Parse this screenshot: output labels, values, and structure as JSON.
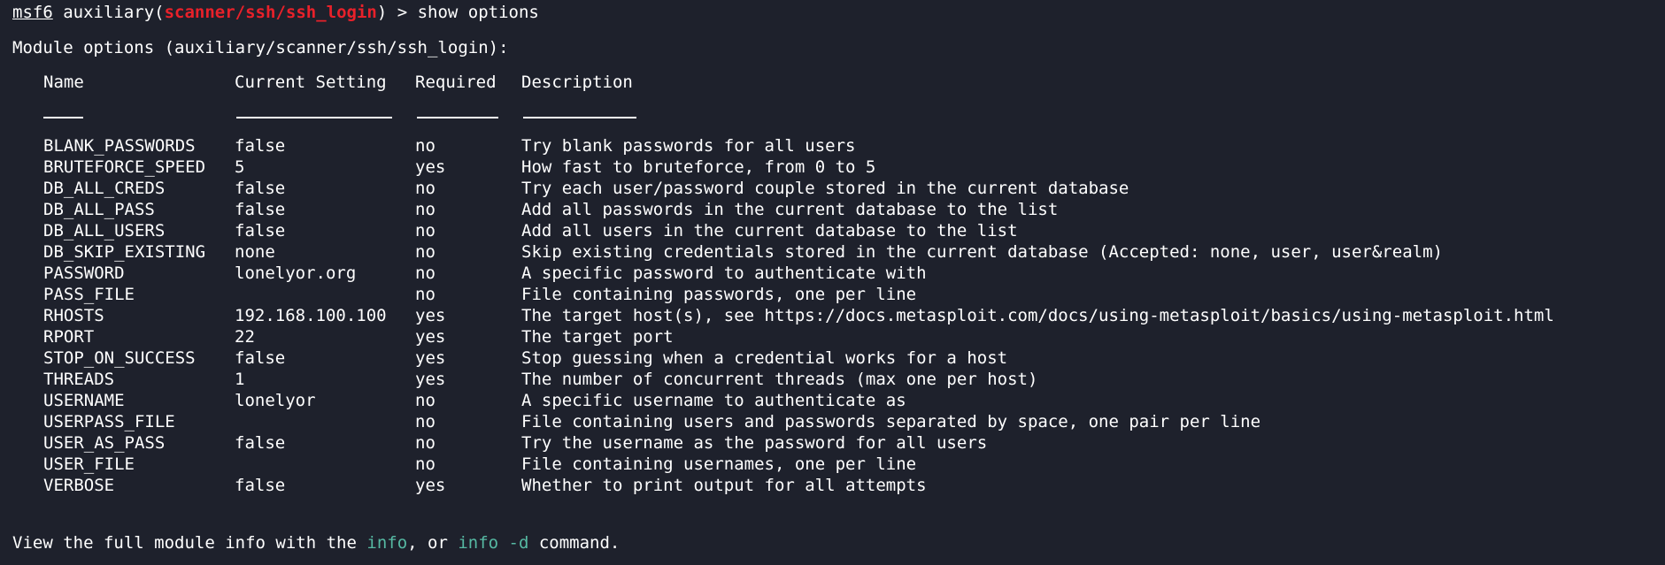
{
  "colors": {
    "background": "#1e212c",
    "text": "#ffffff",
    "module_red": "#e8212a",
    "command_cyan": "#56b9a3"
  },
  "prompt": {
    "msf": "msf6",
    "type": " auxiliary(",
    "module": "scanner/ssh/ssh_login",
    "close": ") > ",
    "command": "show options"
  },
  "module_header": "Module options (auxiliary/scanner/ssh/ssh_login):",
  "table": {
    "headers": {
      "name": "Name",
      "setting": "Current Setting",
      "required": "Required",
      "description": "Description"
    },
    "rows": [
      {
        "name": "BLANK_PASSWORDS",
        "setting": "false",
        "required": "no",
        "description": "Try blank passwords for all users"
      },
      {
        "name": "BRUTEFORCE_SPEED",
        "setting": "5",
        "required": "yes",
        "description": "How fast to bruteforce, from 0 to 5"
      },
      {
        "name": "DB_ALL_CREDS",
        "setting": "false",
        "required": "no",
        "description": "Try each user/password couple stored in the current database"
      },
      {
        "name": "DB_ALL_PASS",
        "setting": "false",
        "required": "no",
        "description": "Add all passwords in the current database to the list"
      },
      {
        "name": "DB_ALL_USERS",
        "setting": "false",
        "required": "no",
        "description": "Add all users in the current database to the list"
      },
      {
        "name": "DB_SKIP_EXISTING",
        "setting": "none",
        "required": "no",
        "description": "Skip existing credentials stored in the current database (Accepted: none, user, user&realm)"
      },
      {
        "name": "PASSWORD",
        "setting": "lonelyor.org",
        "required": "no",
        "description": "A specific password to authenticate with"
      },
      {
        "name": "PASS_FILE",
        "setting": "",
        "required": "no",
        "description": "File containing passwords, one per line"
      },
      {
        "name": "RHOSTS",
        "setting": "192.168.100.100",
        "required": "yes",
        "description": "The target host(s), see https://docs.metasploit.com/docs/using-metasploit/basics/using-metasploit.html"
      },
      {
        "name": "RPORT",
        "setting": "22",
        "required": "yes",
        "description": "The target port"
      },
      {
        "name": "STOP_ON_SUCCESS",
        "setting": "false",
        "required": "yes",
        "description": "Stop guessing when a credential works for a host"
      },
      {
        "name": "THREADS",
        "setting": "1",
        "required": "yes",
        "description": "The number of concurrent threads (max one per host)"
      },
      {
        "name": "USERNAME",
        "setting": "lonelyor",
        "required": "no",
        "description": "A specific username to authenticate as"
      },
      {
        "name": "USERPASS_FILE",
        "setting": "",
        "required": "no",
        "description": "File containing users and passwords separated by space, one pair per line"
      },
      {
        "name": "USER_AS_PASS",
        "setting": "false",
        "required": "no",
        "description": "Try the username as the password for all users"
      },
      {
        "name": "USER_FILE",
        "setting": "",
        "required": "no",
        "description": "File containing usernames, one per line"
      },
      {
        "name": "VERBOSE",
        "setting": "false",
        "required": "yes",
        "description": "Whether to print output for all attempts"
      }
    ]
  },
  "footer": {
    "part1": "View the full module info with the ",
    "cmd1": "info",
    "part2": ", or ",
    "cmd2": "info -d",
    "part3": " command."
  }
}
